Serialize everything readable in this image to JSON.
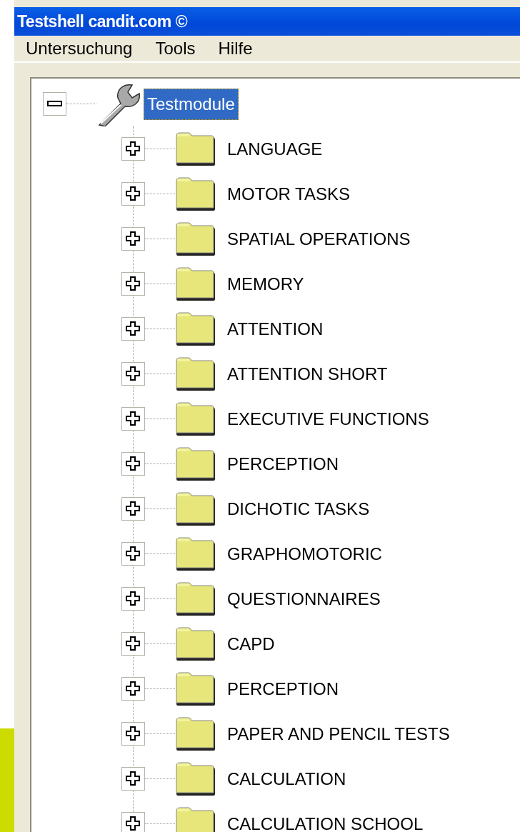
{
  "window": {
    "title": "Testshell candit.com ©"
  },
  "menu": [
    "Untersuchung",
    "Tools",
    "Hilfe"
  ],
  "tree": [
    {
      "label": "Testmodule",
      "kind": "tool",
      "expanded": true,
      "selected": true,
      "children": [
        {
          "label": "LANGUAGE",
          "kind": "folder",
          "expanded": false,
          "selected": false
        },
        {
          "label": "MOTOR TASKS",
          "kind": "folder",
          "expanded": false,
          "selected": false
        },
        {
          "label": "SPATIAL OPERATIONS",
          "kind": "folder",
          "expanded": false,
          "selected": false
        },
        {
          "label": "MEMORY",
          "kind": "folder",
          "expanded": false,
          "selected": false
        },
        {
          "label": "ATTENTION",
          "kind": "folder",
          "expanded": false,
          "selected": false
        },
        {
          "label": "ATTENTION SHORT",
          "kind": "folder",
          "expanded": false,
          "selected": false
        },
        {
          "label": "EXECUTIVE FUNCTIONS",
          "kind": "folder",
          "expanded": false,
          "selected": false
        },
        {
          "label": "PERCEPTION",
          "kind": "folder",
          "expanded": false,
          "selected": false
        },
        {
          "label": "DICHOTIC TASKS",
          "kind": "folder",
          "expanded": false,
          "selected": false
        },
        {
          "label": "GRAPHOMOTORIC",
          "kind": "folder",
          "expanded": false,
          "selected": false
        },
        {
          "label": "QUESTIONNAIRES",
          "kind": "folder",
          "expanded": false,
          "selected": false
        },
        {
          "label": "CAPD",
          "kind": "folder",
          "expanded": false,
          "selected": false
        },
        {
          "label": "PERCEPTION",
          "kind": "folder",
          "expanded": false,
          "selected": false
        },
        {
          "label": "PAPER AND PENCIL TESTS",
          "kind": "folder",
          "expanded": false,
          "selected": false
        },
        {
          "label": "CALCULATION",
          "kind": "folder",
          "expanded": false,
          "selected": false
        },
        {
          "label": "CALCULATION SCHOOL",
          "kind": "folder",
          "expanded": false,
          "selected": false
        }
      ]
    }
  ]
}
